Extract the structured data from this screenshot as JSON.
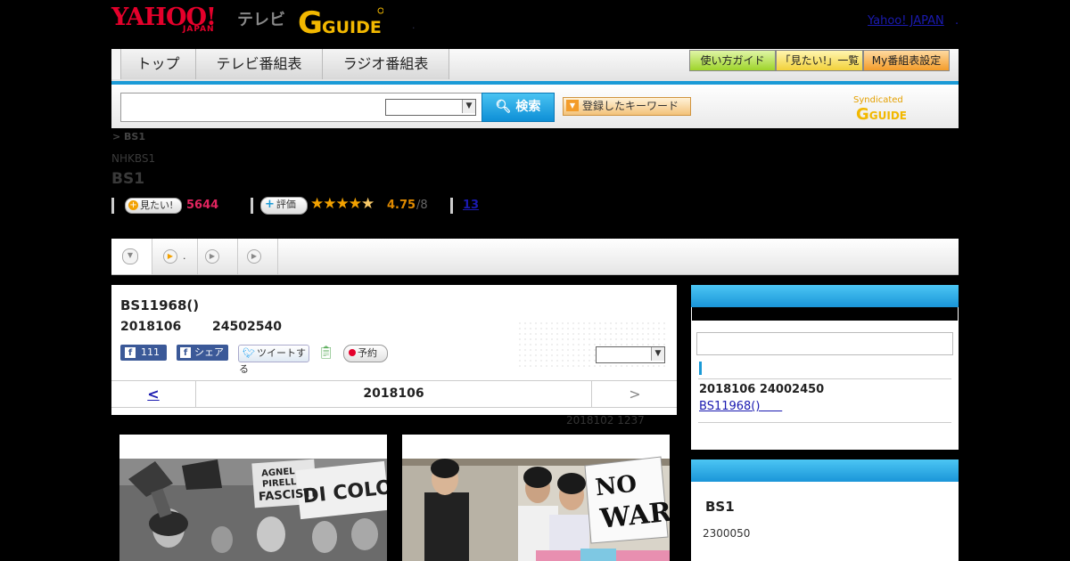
{
  "header": {
    "logo_yahoo": "YAHOO!",
    "logo_japan": "JAPAN",
    "logo_tv": "テレビ",
    "logo_gguide": "GUIDE",
    "dot": ".",
    "yahoo_japan_link": "Yahoo! JAPAN",
    "link_dot": "."
  },
  "nav": {
    "tabs": [
      "トップ",
      "テレビ番組表",
      "ラジオ番組表"
    ],
    "right_buttons": [
      "使い方ガイド",
      "「見たい!」一覧",
      "My番組表設定"
    ]
  },
  "search": {
    "button_label": "検索",
    "keyword_button": "登録したキーワード",
    "syndicated": "Syndicated",
    "syndicated_logo": "GUIDE"
  },
  "channel": {
    "breadcrumb": "> BS1",
    "network": "NHKBS1",
    "name": "BS1",
    "mitai_label": "見たい!",
    "mitai_count": "5644",
    "hyoka_label": "評価",
    "rating": "4.75",
    "rating_suffix": "/8",
    "rating_stars": 5,
    "link_count": "13"
  },
  "tabs": [
    {
      "label": "",
      "icon": "chevron-down-icon"
    },
    {
      "label": ".",
      "icon": "play-icon"
    },
    {
      "label": "",
      "icon": "play-icon"
    },
    {
      "label": "",
      "icon": "play-icon"
    }
  ],
  "program": {
    "title": "BS11968()",
    "date": "2018106",
    "time": "24502540",
    "fb_like_count": "111",
    "fb_share": "シェア",
    "tweet": "ツイートする",
    "reserve": "予約",
    "prev": "<",
    "current_date": "2018106",
    "next": ">",
    "updated": "2018102  1237"
  },
  "sidebar": {
    "box1": {
      "date_time": "2018106  24002450",
      "link": "BS11968()"
    },
    "box2": {
      "channel": "BS1",
      "text": "2300050"
    }
  },
  "photos": {
    "photo1_text": [
      "AGNEL",
      "PIRELL",
      "FASCISTI",
      "DI COLO"
    ],
    "photo2_text": [
      "NO",
      "WAR"
    ]
  },
  "colors": {
    "accent_blue": "#1a9ad6",
    "yahoo_red": "#e4002b",
    "mitai_pink": "#e0245e",
    "rating_orange": "#e08a00",
    "link_blue": "#1a1ab0"
  }
}
